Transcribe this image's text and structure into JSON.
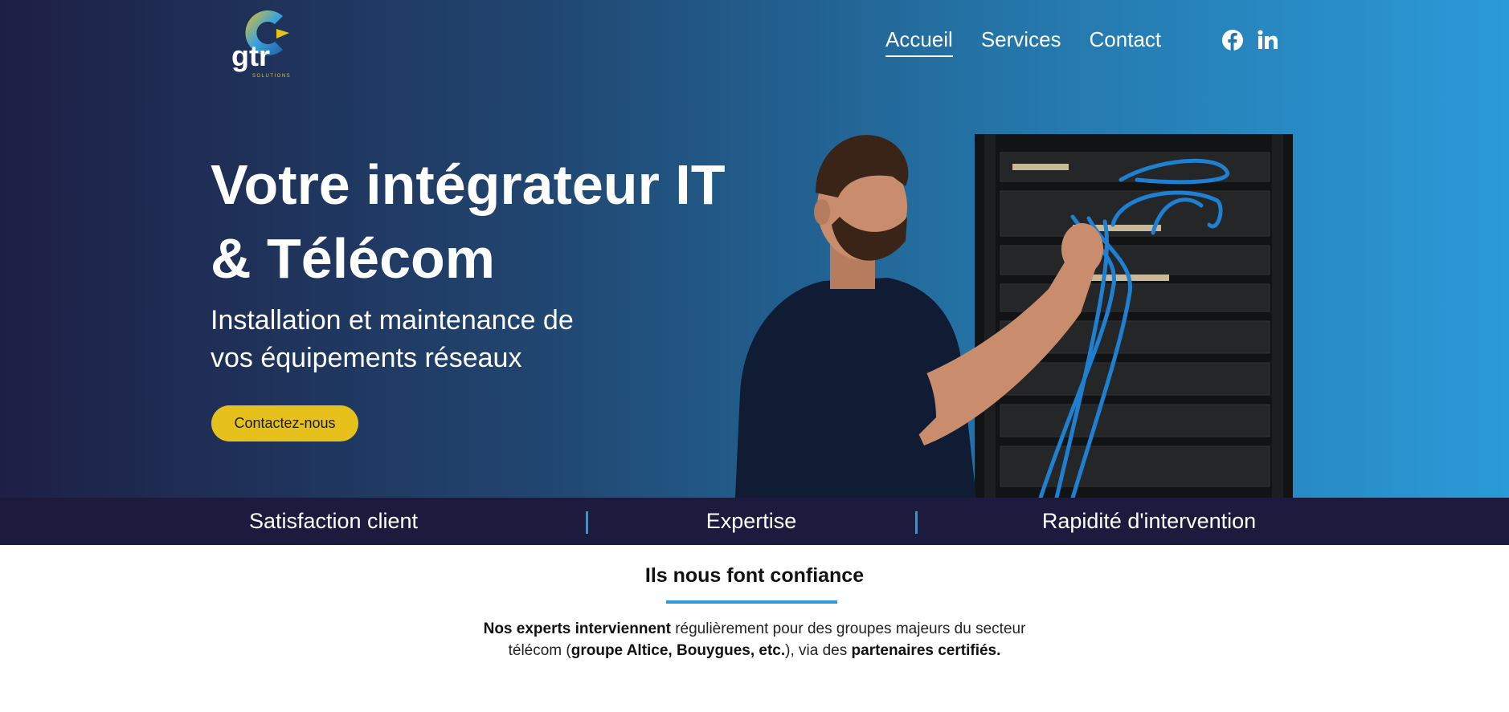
{
  "brand": {
    "logo_text": "gtr",
    "logo_subtext": "SOLUTIONS"
  },
  "nav": {
    "items": [
      "Accueil",
      "Services",
      "Contact"
    ],
    "active": "Accueil"
  },
  "social": {
    "facebook": "facebook-icon",
    "linkedin": "linkedin-icon"
  },
  "hero": {
    "title_line1": "Votre intégrateur IT",
    "title_line2": "& Télécom",
    "subtitle_line1": "Installation et maintenance de",
    "subtitle_line2": "vos équipements réseaux",
    "cta_label": "Contactez-nous"
  },
  "stats": {
    "items": [
      "Satisfaction client",
      "Expertise",
      "Rapidité d'intervention"
    ]
  },
  "trust": {
    "title": "Ils nous font confiance",
    "text_part1_bold": "Nos experts interviennent",
    "text_part2": " régulièrement pour des groupes majeurs du secteur télécom (",
    "text_part3_bold": "groupe Altice, Bouygues, etc.",
    "text_part4": "), via des ",
    "text_part5_bold": "partenaires certifiés."
  },
  "colors": {
    "accent": "#2b9ad8",
    "cta": "#e6c11b",
    "dark_navy": "#1c1b3d"
  }
}
